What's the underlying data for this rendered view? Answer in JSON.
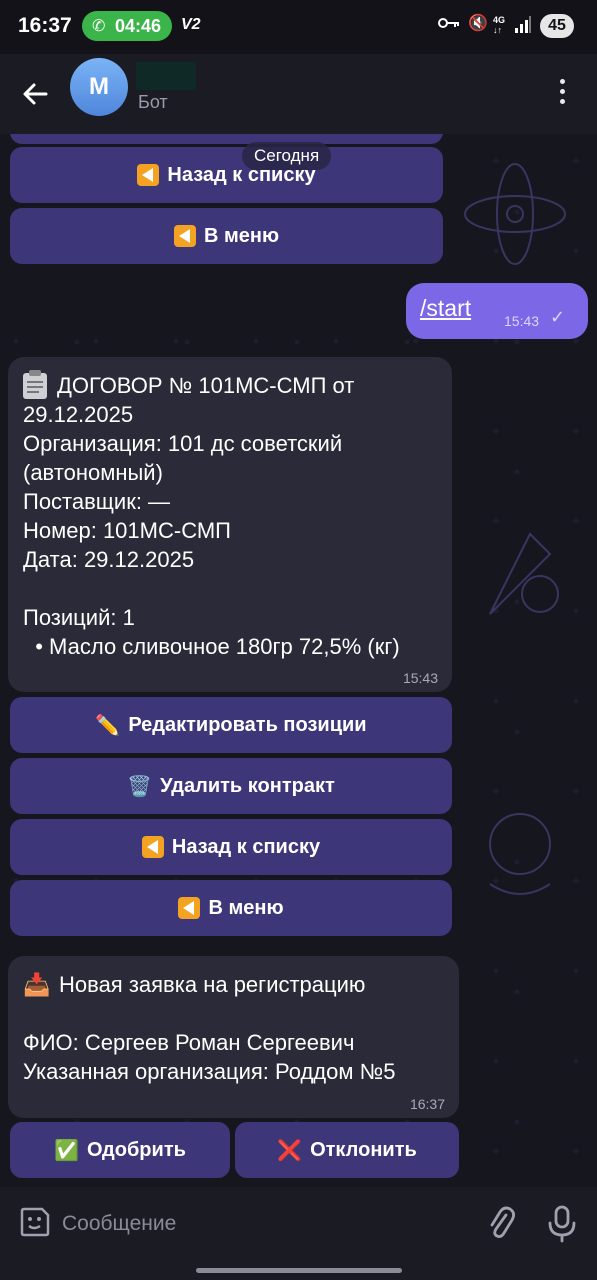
{
  "status_bar": {
    "time": "16:37",
    "call_timer": "04:46",
    "network_label": "V2",
    "net_type_top": "4G",
    "net_type_bottom": "↓↑",
    "battery": "45",
    "icons": [
      "phone-icon",
      "key-icon",
      "mute-icon",
      "signal-icon"
    ]
  },
  "header": {
    "avatar_letter": "M",
    "subtitle": "Бот",
    "icons": [
      "back-arrow-icon",
      "more-vertical-icon"
    ]
  },
  "chat": {
    "date_pill": "Сегодня",
    "top_keyboard": [
      {
        "label": "Назад к списку",
        "icon": "back-arrow-emoji"
      },
      {
        "label": "В меню",
        "icon": "back-arrow-emoji"
      }
    ],
    "outgoing": {
      "text": "/start",
      "time": "15:43",
      "status_icon": "check-icon"
    },
    "contract_message": {
      "icon": "clipboard-emoji",
      "text": "ДОГОВОР № 101МС-СМП от 29.12.2025\nОрганизация: 101 дс советский (автономный)\nПоставщик: —\nНомер: 101МС-СМП\nДата: 29.12.2025\n\nПозиций: 1\n  • Масло сливочное 180гр 72,5% (кг)",
      "time": "15:43"
    },
    "contract_keyboard": [
      {
        "label": "Редактировать позиции",
        "icon": "✏️"
      },
      {
        "label": "Удалить контракт",
        "icon": "🗑️"
      },
      {
        "label": "Назад к списку",
        "icon": "back-arrow-emoji"
      },
      {
        "label": "В меню",
        "icon": "back-arrow-emoji"
      }
    ],
    "registration_message": {
      "icon": "📥",
      "text": "Новая заявка на регистрацию\n\nФИО: Сергеев Роман Сергеевич\nУказанная организация: Роддом №5",
      "time": "16:37"
    },
    "registration_keyboard": [
      {
        "label": "Одобрить",
        "icon": "✅"
      },
      {
        "label": "Отклонить",
        "icon": "❌"
      }
    ]
  },
  "input_bar": {
    "placeholder": "Сообщение",
    "icons": [
      "emoji-sticker-icon",
      "paperclip-icon",
      "microphone-icon"
    ]
  },
  "colors": {
    "accent_button": "#3d3678",
    "outgoing_bubble": "#7c67e6",
    "incoming_bubble": "#2a2a38",
    "call_pill": "#3bb54a"
  }
}
